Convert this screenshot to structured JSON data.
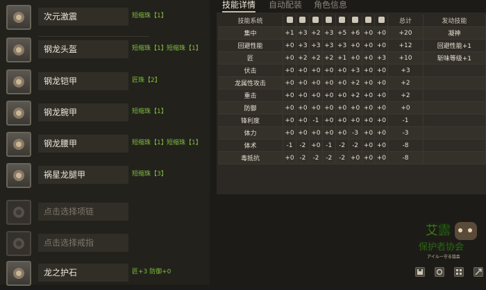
{
  "equipment": [
    {
      "name": "次元激震",
      "jewels": [
        "短缩珠【1】"
      ],
      "icon": "hammer-icon"
    },
    {
      "name": "钢龙头盔",
      "jewels": [
        "短缩珠【1】",
        "短缩珠【1】"
      ],
      "icon": "helmet-icon"
    },
    {
      "name": "钢龙铠甲",
      "jewels": [
        "匠珠【2】"
      ],
      "icon": "chest-armor-icon"
    },
    {
      "name": "钢龙腕甲",
      "jewels": [
        "短缩珠【1】"
      ],
      "icon": "gauntlet-icon"
    },
    {
      "name": "钢龙腰甲",
      "jewels": [
        "短缩珠【1】",
        "短缩珠【1】"
      ],
      "icon": "waist-armor-icon"
    },
    {
      "name": "祸星龙腿甲",
      "jewels": [
        "短缩珠【3】"
      ],
      "icon": "leg-armor-icon"
    },
    {
      "name": "点击选择项链",
      "jewels": [],
      "icon": "necklace-icon"
    },
    {
      "name": "点击选择戒指",
      "jewels": [],
      "icon": "ring-icon"
    },
    {
      "name": "龙之护石",
      "jewels": [
        "匠+3 防御+0"
      ],
      "icon": "talisman-icon"
    }
  ],
  "tabs": [
    "技能详情",
    "自动配装",
    "角色信息"
  ],
  "table": {
    "header_skill": "技能系统",
    "header_total": "总计",
    "header_active": "发动技能",
    "slot_icons": [
      "weapon-icon",
      "helmet-icon",
      "chest-icon",
      "arm-icon",
      "waist-icon",
      "leg-icon",
      "necklace-icon",
      "ring-icon"
    ],
    "rows": [
      {
        "skill": "集中",
        "vals": [
          "+1",
          "+3",
          "+2",
          "+3",
          "+5",
          "+6",
          "+0",
          "+0"
        ],
        "total": "+20",
        "active": "凝神"
      },
      {
        "skill": "回避性能",
        "vals": [
          "+0",
          "+3",
          "+3",
          "+3",
          "+3",
          "+0",
          "+0",
          "+0"
        ],
        "total": "+12",
        "active": "回避性能+1"
      },
      {
        "skill": "匠",
        "vals": [
          "+0",
          "+2",
          "+2",
          "+2",
          "+1",
          "+0",
          "+0",
          "+3"
        ],
        "total": "+10",
        "active": "斩味等级+1"
      },
      {
        "skill": "伏击",
        "vals": [
          "+0",
          "+0",
          "+0",
          "+0",
          "+0",
          "+3",
          "+0",
          "+0"
        ],
        "total": "+3",
        "active": ""
      },
      {
        "skill": "龙属性攻击",
        "vals": [
          "+0",
          "+0",
          "+0",
          "+0",
          "+0",
          "+2",
          "+0",
          "+0"
        ],
        "total": "+2",
        "active": ""
      },
      {
        "skill": "重击",
        "vals": [
          "+0",
          "+0",
          "+0",
          "+0",
          "+0",
          "+2",
          "+0",
          "+0"
        ],
        "total": "+2",
        "active": ""
      },
      {
        "skill": "防御",
        "vals": [
          "+0",
          "+0",
          "+0",
          "+0",
          "+0",
          "+0",
          "+0",
          "+0"
        ],
        "total": "+0",
        "active": ""
      },
      {
        "skill": "锋利度",
        "vals": [
          "+0",
          "+0",
          "-1",
          "+0",
          "+0",
          "+0",
          "+0",
          "+0"
        ],
        "total": "-1",
        "active": ""
      },
      {
        "skill": "体力",
        "vals": [
          "+0",
          "+0",
          "+0",
          "+0",
          "+0",
          "-3",
          "+0",
          "+0"
        ],
        "total": "-3",
        "active": ""
      },
      {
        "skill": "体术",
        "vals": [
          "-1",
          "-2",
          "+0",
          "-1",
          "-2",
          "-2",
          "+0",
          "+0"
        ],
        "total": "-8",
        "active": ""
      },
      {
        "skill": "毒抵抗",
        "vals": [
          "+0",
          "-2",
          "-2",
          "-2",
          "-2",
          "+0",
          "+0",
          "+0"
        ],
        "total": "-8",
        "active": ""
      }
    ]
  },
  "watermark": {
    "line1": "艾露",
    "line2": "保护者协会",
    "line3": "アイルー守る協会"
  },
  "colors": {
    "jewel": "#7fbf3f",
    "panel": "#2c2924",
    "background": "#1d1b17"
  }
}
